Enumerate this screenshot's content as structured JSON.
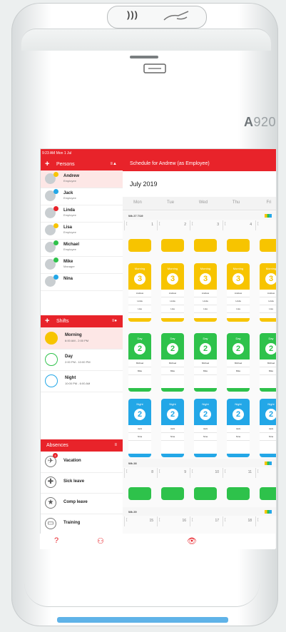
{
  "device": {
    "nfc_text": ")))",
    "brand_prefix": "A",
    "brand_model": "920"
  },
  "status": {
    "time": "9:23 AM  Mon 1 Jul"
  },
  "persons": {
    "header": "Persons",
    "plus": "+",
    "sort": "≡▲",
    "items": [
      {
        "name": "Andrew",
        "role": "Employee",
        "dot": "#f7c400",
        "selected": true
      },
      {
        "name": "Jack",
        "role": "Employee",
        "dot": "#23a7e7"
      },
      {
        "name": "Linda",
        "role": "Employee",
        "dot": "#e8232a"
      },
      {
        "name": "Lisa",
        "role": "Employee",
        "dot": "#f7c400"
      },
      {
        "name": "Michael",
        "role": "Employee",
        "dot": "#2ec24b"
      },
      {
        "name": "Mike",
        "role": "Manager",
        "dot": "#2ec24b"
      },
      {
        "name": "Nina",
        "role": "",
        "dot": "#23a7e7"
      }
    ]
  },
  "shifts": {
    "header": "Shifts",
    "plus": "+",
    "sort": "≡●",
    "items": [
      {
        "name": "Morning",
        "time": "6:00 AM - 2:00 PM",
        "color": "#f7c400",
        "filled": true,
        "selected": true
      },
      {
        "name": "Day",
        "time": "2:00 PM - 10:00 PM",
        "color": "#2ec24b",
        "filled": false
      },
      {
        "name": "Night",
        "time": "10:00 PM - 6:00 AM",
        "color": "#23a7e7",
        "filled": false
      }
    ]
  },
  "absences": {
    "header": "Absences",
    "sort": "≡",
    "items": [
      {
        "name": "Vacation",
        "badge": "4"
      },
      {
        "name": "Sick leave"
      },
      {
        "name": "Comp leave"
      },
      {
        "name": "Training"
      }
    ]
  },
  "schedule": {
    "header": "Schedule for Andrew (as Employee)",
    "month": "July 2019",
    "days": [
      "Mon",
      "Tue",
      "Wed",
      "Thu",
      "Fri"
    ],
    "week1": {
      "label": "Wk 27  7/19",
      "dates": [
        "1",
        "2",
        "3",
        "4",
        "5"
      ]
    },
    "week2": {
      "label": "Wk 28",
      "dates": [
        "8",
        "9",
        "10",
        "11",
        "12"
      ]
    },
    "week3": {
      "label": "Wk 29",
      "dates": [
        "15",
        "16",
        "17",
        "18",
        "19"
      ]
    },
    "morning": {
      "label": "Morning",
      "count": "3",
      "names": [
        "Andrew",
        "Linda",
        "Lisa"
      ],
      "color": "#f7c400"
    },
    "day": {
      "label": "Day",
      "count": "2",
      "names": [
        "Michael",
        "Mike"
      ],
      "color": "#2ec24b"
    },
    "night": {
      "label": "Night",
      "count": "2",
      "names": [
        "Jack",
        "Nina"
      ],
      "color": "#23a7e7"
    }
  },
  "bottombar": {
    "help": "?",
    "people": "⚇",
    "eye": "👁"
  }
}
